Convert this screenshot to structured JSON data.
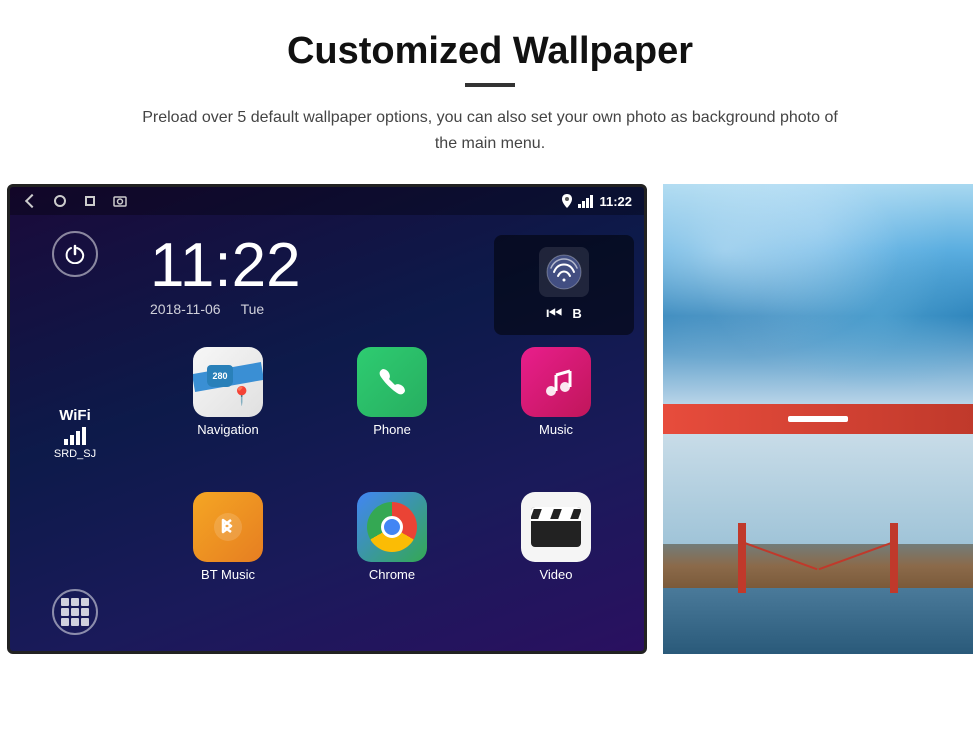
{
  "page": {
    "title": "Customized Wallpaper",
    "divider": true,
    "subtitle": "Preload over 5 default wallpaper options, you can also set your own photo as background photo of the main menu."
  },
  "android": {
    "statusBar": {
      "time": "11:22",
      "navIcons": [
        "back",
        "home",
        "square",
        "screenshot"
      ]
    },
    "clock": {
      "time": "11:22",
      "date": "2018-11-06",
      "day": "Tue"
    },
    "wifi": {
      "label": "WiFi",
      "ssid": "SRD_SJ"
    },
    "apps": [
      {
        "id": "navigation",
        "label": "Navigation",
        "icon": "map-icon"
      },
      {
        "id": "phone",
        "label": "Phone",
        "icon": "phone-icon"
      },
      {
        "id": "music",
        "label": "Music",
        "icon": "music-icon"
      },
      {
        "id": "btmusic",
        "label": "BT Music",
        "icon": "bt-icon"
      },
      {
        "id": "chrome",
        "label": "Chrome",
        "icon": "chrome-icon"
      },
      {
        "id": "video",
        "label": "Video",
        "icon": "video-icon"
      }
    ],
    "mapShieldText": "280"
  }
}
